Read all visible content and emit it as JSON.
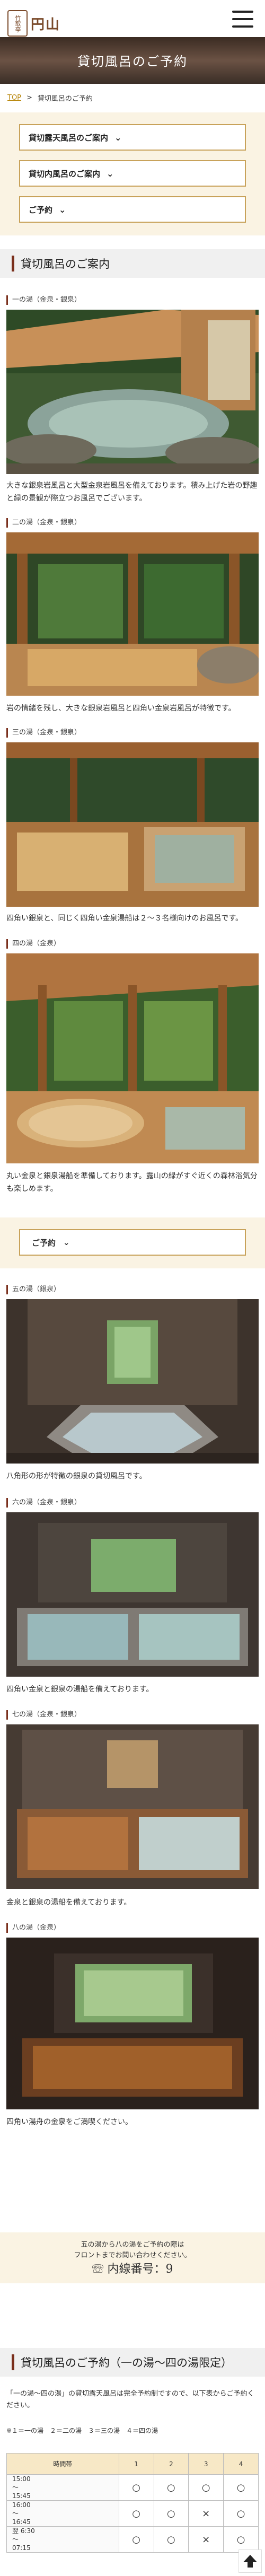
{
  "header": {
    "logo_mark": "竹取亭",
    "logo_text": "円山",
    "menu_icon": "hamburger-menu-icon"
  },
  "hero": {
    "title": "貸切風呂のご予約"
  },
  "breadcrumb": {
    "home": "TOP",
    "sep": ">",
    "current": "貸切風呂のご予約"
  },
  "menu": {
    "outdoor_label": "貸切露天風呂のご案内",
    "indoor_label": "貸切内風呂のご案内",
    "reserve_label": "ご予約"
  },
  "guide": {
    "heading": "貸切風呂のご案内",
    "baths": [
      {
        "label": "一の湯（金泉・銀泉）",
        "desc": "大きな銀泉岩風呂と大型金泉岩風呂を備えております。積み上げた岩の野趣と緑の景観が際立つお風呂でございます。"
      },
      {
        "label": "二の湯（金泉・銀泉）",
        "desc": "岩の情緒を残し、大きな銀泉岩風呂と四角い金泉岩風呂が特徴です。"
      },
      {
        "label": "三の湯（金泉・銀泉）",
        "desc": "四角い銀泉と、同じく四角い金泉湯船は２〜３名様向けのお風呂です。"
      },
      {
        "label": "四の湯（金泉）",
        "desc": "丸い金泉と銀泉湯船を準備しております。露山の緑がすぐ近くの森林浴気分も楽しめます。"
      }
    ],
    "reserve_button": "ご予約",
    "indoor_baths": [
      {
        "label": "五の湯（銀泉）",
        "desc": "八角形の形が特徴の銀泉の貸切風呂です。"
      },
      {
        "label": "六の湯（金泉・銀泉）",
        "desc": "四角い金泉と銀泉の湯船を備えております。"
      },
      {
        "label": "七の湯（金泉・銀泉）",
        "desc": "金泉と銀泉の湯船を備えております。"
      },
      {
        "label": "八の湯（金泉）",
        "desc": "四角い湯舟の金泉をご満喫ください。"
      }
    ]
  },
  "tel_box": {
    "line1": "五の湯から八の湯をご予約の際は",
    "line2": "フロントまでお問い合わせください。",
    "tel_prefix": "☏",
    "tel_label": "内線番号：9"
  },
  "schedule": {
    "heading": "貸切風呂のご予約（一の湯〜四の湯限定）",
    "note": "「一の湯〜四の湯」の貸切露天風呂は完全予約制ですので、以下表からご予約ください。",
    "legend": "※１＝一の湯　２＝二の湯　３＝三の湯　４＝四の湯",
    "columns": [
      "時間帯",
      "1",
      "2",
      "3",
      "4"
    ],
    "rows": [
      {
        "time": "15:00\n〜\n15:45",
        "marks": [
          "○",
          "○",
          "○",
          "○"
        ]
      },
      {
        "time": "16:00\n〜\n16:45",
        "marks": [
          "○",
          "○",
          "×",
          "○"
        ]
      },
      {
        "time": "翌 6:30\n〜\n07:15",
        "marks": [
          "○",
          "○",
          "×",
          "○"
        ]
      }
    ]
  },
  "colors": {
    "accent": "#c8a25a",
    "brand": "#7a2f1c",
    "bg_cream": "#faf3e3"
  }
}
